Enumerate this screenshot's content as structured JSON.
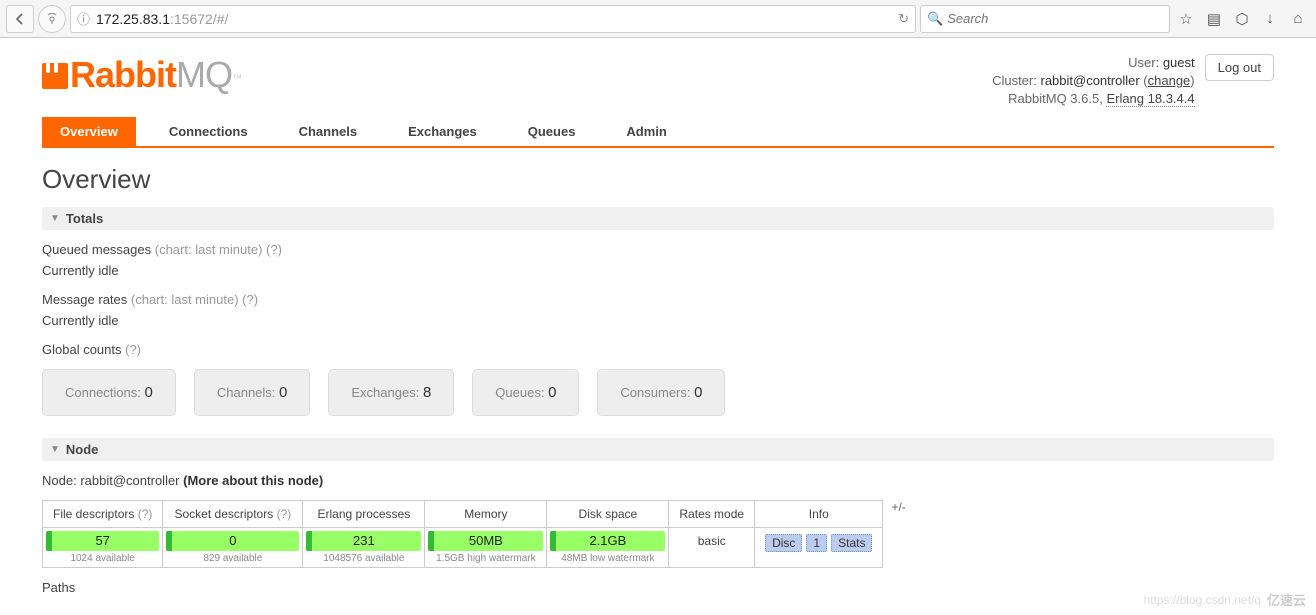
{
  "browser": {
    "url_host": "172.25.83.1",
    "url_path": ":15672/#/",
    "search_placeholder": "Search"
  },
  "userinfo": {
    "user_label": "User:",
    "user_value": "guest",
    "cluster_label": "Cluster:",
    "cluster_value": "rabbit@controller",
    "change_link": "change",
    "version": "RabbitMQ 3.6.5,",
    "erlang": "Erlang 18.3.4.4",
    "logout": "Log out"
  },
  "logo": {
    "brand1": "Rabbit",
    "brand2": "MQ"
  },
  "tabs": [
    {
      "label": "Overview",
      "active": true
    },
    {
      "label": "Connections",
      "active": false
    },
    {
      "label": "Channels",
      "active": false
    },
    {
      "label": "Exchanges",
      "active": false
    },
    {
      "label": "Queues",
      "active": false
    },
    {
      "label": "Admin",
      "active": false
    }
  ],
  "page_title": "Overview",
  "sections": {
    "totals_title": "Totals",
    "node_title": "Node"
  },
  "totals": {
    "queued_label": "Queued messages",
    "chart_hint": "(chart: last minute)",
    "help": "(?)",
    "idle1": "Currently idle",
    "rates_label": "Message rates",
    "idle2": "Currently idle",
    "global_label": "Global counts"
  },
  "counts": [
    {
      "label": "Connections:",
      "value": "0"
    },
    {
      "label": "Channels:",
      "value": "0"
    },
    {
      "label": "Exchanges:",
      "value": "8"
    },
    {
      "label": "Queues:",
      "value": "0"
    },
    {
      "label": "Consumers:",
      "value": "0"
    }
  ],
  "node": {
    "line_label": "Node:",
    "line_value": "rabbit@controller",
    "more_link": "(More about this node)",
    "plusminus": "+/-",
    "headers": {
      "fd": "File descriptors",
      "sd": "Socket descriptors",
      "ep": "Erlang processes",
      "mem": "Memory",
      "disk": "Disk space",
      "rates": "Rates mode",
      "info": "Info"
    },
    "cells": {
      "fd_val": "57",
      "fd_sub": "1024 available",
      "sd_val": "0",
      "sd_sub": "829 available",
      "ep_val": "231",
      "ep_sub": "1048576 available",
      "mem_val": "50MB",
      "mem_sub": "1.5GB high watermark",
      "disk_val": "2.1GB",
      "disk_sub": "48MB low watermark",
      "rates_val": "basic",
      "info_badges": [
        "Disc",
        "1",
        "Stats"
      ]
    }
  },
  "paths_label": "Paths",
  "watermark": {
    "url": "https://blog.csdn.net/q",
    "brand": "亿速云"
  }
}
